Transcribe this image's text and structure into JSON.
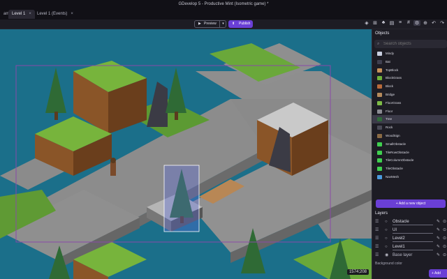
{
  "window": {
    "title": "GDevelop 5 - Productive Mint (Isometric game) *"
  },
  "tabs": [
    {
      "label": "ame",
      "close": ""
    },
    {
      "label": "Level 1",
      "close": "×"
    },
    {
      "label": "Level 1 (Events)",
      "close": "×"
    }
  ],
  "toolbar": {
    "preview_label": "Preview",
    "preview_dropdown": "▾",
    "publish_label": "Publish",
    "icons": [
      "layers-icon",
      "objects-icon",
      "tree-icon",
      "properties-icon",
      "list-icon",
      "grid-icon",
      "settings-icon",
      "undo-icon",
      "redo-icon"
    ]
  },
  "canvas": {
    "coords": "1574;208"
  },
  "objects_panel": {
    "title": "Objects",
    "search_placeholder": "Search objects",
    "items": [
      {
        "name": "Mindy",
        "color": "#c9cfe0"
      },
      {
        "name": "Bat",
        "color": "#3f3f4f"
      },
      {
        "name": "TopBlock",
        "color": "#c8925a"
      },
      {
        "name": "BlockGrass",
        "color": "#6fb33a"
      },
      {
        "name": "Block",
        "color": "#b86a3a"
      },
      {
        "name": "Bridge",
        "color": "#b58a5b"
      },
      {
        "name": "FloorGrass",
        "color": "#7dba46"
      },
      {
        "name": "Floor",
        "color": "#8a8a92"
      },
      {
        "name": "Tree",
        "color": "#2f6a3a"
      },
      {
        "name": "Rock",
        "color": "#4a4a56"
      },
      {
        "name": "WoodSign",
        "color": "#8a6a44"
      },
      {
        "name": "SmallObstacle",
        "color": "#3fcf4f"
      },
      {
        "name": "TileRowObstacle",
        "color": "#3fcf4f"
      },
      {
        "name": "TileColumnObstacle",
        "color": "#3fcf4f"
      },
      {
        "name": "TileObstacle",
        "color": "#3fcf4f"
      },
      {
        "name": "NavMesh",
        "color": "#4a9ade"
      }
    ],
    "selected": "Tree",
    "add_label": "Add a new object"
  },
  "layers_panel": {
    "title": "Layers",
    "layers": [
      {
        "name": "Obstacle"
      },
      {
        "name": "UI"
      },
      {
        "name": "Level2"
      },
      {
        "name": "Level1"
      },
      {
        "name": "Base layer"
      }
    ],
    "background_label": "Background color",
    "add_label": "Add"
  }
}
